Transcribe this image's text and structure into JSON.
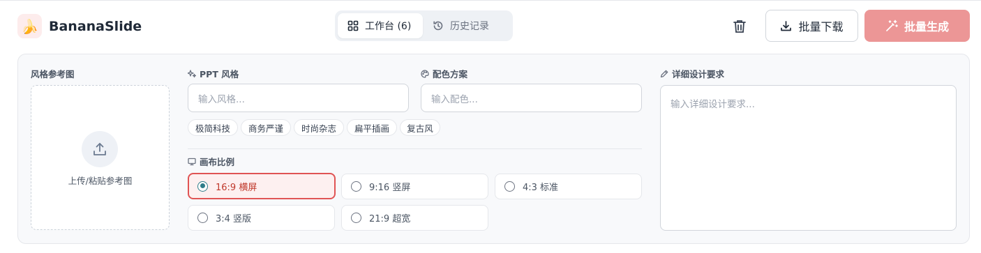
{
  "app": {
    "name": "BananaSlide",
    "logo_glyph": "🍌"
  },
  "header": {
    "tabs": [
      {
        "label": "工作台 (6)",
        "icon": "grid-icon",
        "active": true
      },
      {
        "label": "历史记录",
        "icon": "history-icon",
        "active": false
      }
    ],
    "delete_icon": "trash-icon",
    "download_label": "批量下载",
    "generate_label": "批量生成",
    "accent_color": "#ec9696"
  },
  "style_reference": {
    "label": "风格参考图",
    "upload_text": "上传/粘贴参考图",
    "upload_icon": "upload-icon"
  },
  "ppt_style": {
    "label": "PPT 风格",
    "placeholder": "输入风格...",
    "presets": [
      "极简科技",
      "商务严谨",
      "时尚杂志",
      "扁平插画",
      "复古风"
    ]
  },
  "color_scheme": {
    "label": "配色方案",
    "placeholder": "输入配色..."
  },
  "design_requirements": {
    "label": "详细设计要求",
    "placeholder": "输入详细设计要求..."
  },
  "canvas_ratio": {
    "label": "画布比例",
    "options": [
      {
        "label": "16:9 横屏",
        "selected": true
      },
      {
        "label": "9:16 竖屏",
        "selected": false
      },
      {
        "label": "4:3 标准",
        "selected": false
      },
      {
        "label": "3:4 竖版",
        "selected": false
      },
      {
        "label": "21:9 超宽",
        "selected": false
      }
    ]
  }
}
